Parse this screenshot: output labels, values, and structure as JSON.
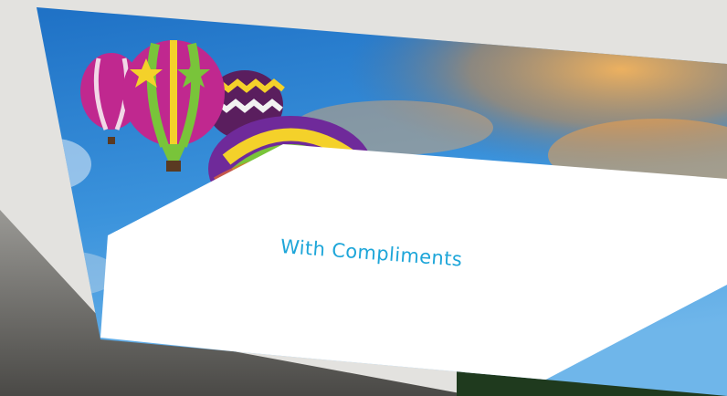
{
  "photo": {
    "subject": "compliments-card",
    "card_text": "With Compliments"
  },
  "palette": {
    "sky_top": "#1d6fc4",
    "sky_mid": "#3b93dc",
    "cloud_orange": "#f0a04a",
    "card_white": "#ffffff",
    "text_blue": "#1ea6d9",
    "balloon_magenta": "#c0288f",
    "balloon_green": "#79c43a",
    "balloon_yellow": "#f4d12a"
  }
}
